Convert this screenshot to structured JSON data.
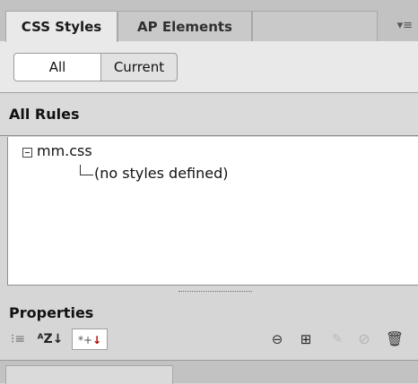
{
  "tabs": [
    {
      "label": "CSS Styles",
      "active": true
    },
    {
      "label": "AP Elements",
      "active": false
    }
  ],
  "panel_menu_icon": "options-menu-icon",
  "view_toggle": {
    "all_label": "All",
    "current_label": "Current",
    "selected": "All"
  },
  "rules": {
    "header": "All Rules",
    "tree": {
      "root_label": "mm.css",
      "child_label": "(no styles defined)"
    }
  },
  "properties": {
    "header": "Properties",
    "toolbar": {
      "category_view": {
        "icon": "category-view-icon",
        "glyph": "⁝≡"
      },
      "alpha_view": {
        "icon": "alphabetical-view-icon",
        "glyph": "ᴬZ↓"
      },
      "set_view": {
        "icon": "show-set-properties-icon",
        "glyph": "*+",
        "arrow": "↓"
      },
      "attach": {
        "icon": "attach-stylesheet-icon",
        "glyph": "⊖"
      },
      "new_rule": {
        "icon": "new-css-rule-icon",
        "glyph": "⊞"
      },
      "edit": {
        "icon": "edit-rule-icon",
        "glyph": "✎"
      },
      "disable": {
        "icon": "disable-property-icon",
        "glyph": "⊘"
      },
      "delete": {
        "icon": "delete-rule-icon",
        "glyph": "🗑"
      }
    }
  },
  "colors": {
    "panel_bg": "#e9e9e9",
    "tabbar_bg": "#c2c2c2",
    "tree_bg": "#ffffff",
    "active_arrow": "#b00000"
  }
}
